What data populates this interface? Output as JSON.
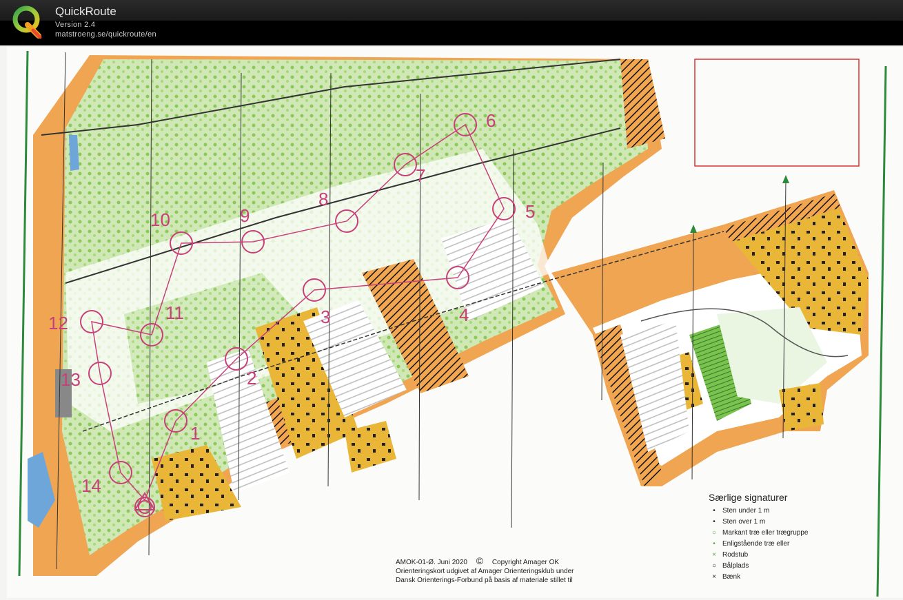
{
  "app": {
    "name": "QuickRoute",
    "version": "Version 2.4",
    "url": "matstroeng.se/quickroute/en"
  },
  "map": {
    "control_numbers": [
      "1",
      "2",
      "3",
      "4",
      "5",
      "6",
      "7",
      "8",
      "9",
      "10",
      "11",
      "12",
      "13",
      "14"
    ],
    "legend": {
      "title": "Særlige signaturer",
      "items": [
        {
          "symbol": "•",
          "label": "Sten under 1 m"
        },
        {
          "symbol": "•",
          "label": "Sten over 1 m"
        },
        {
          "symbol": "○",
          "label": "Markant træ eller trægruppe"
        },
        {
          "symbol": "•",
          "label": "Enligstående træ eller"
        },
        {
          "symbol": "×",
          "label": "Rodstub"
        },
        {
          "symbol": "○",
          "label": "Bålplads"
        },
        {
          "symbol": "×",
          "label": "Bænk"
        }
      ]
    },
    "footer": {
      "code": "AMOK-01-Ø. Juni 2020",
      "copyright_symbol": "©",
      "copyright": "Copyright Amager OK",
      "line2": "Orienteringskort udgivet af Amager Orienteringsklub under",
      "line3": "Dansk Orienterings-Forbund på basis af materiale stillet til"
    },
    "colors": {
      "course": "#c8407a",
      "open_land": "#f0a552",
      "forest_green": "#8cc95a",
      "settlement": "#e9b638",
      "water": "#6fa6d9",
      "black": "#111111"
    }
  }
}
